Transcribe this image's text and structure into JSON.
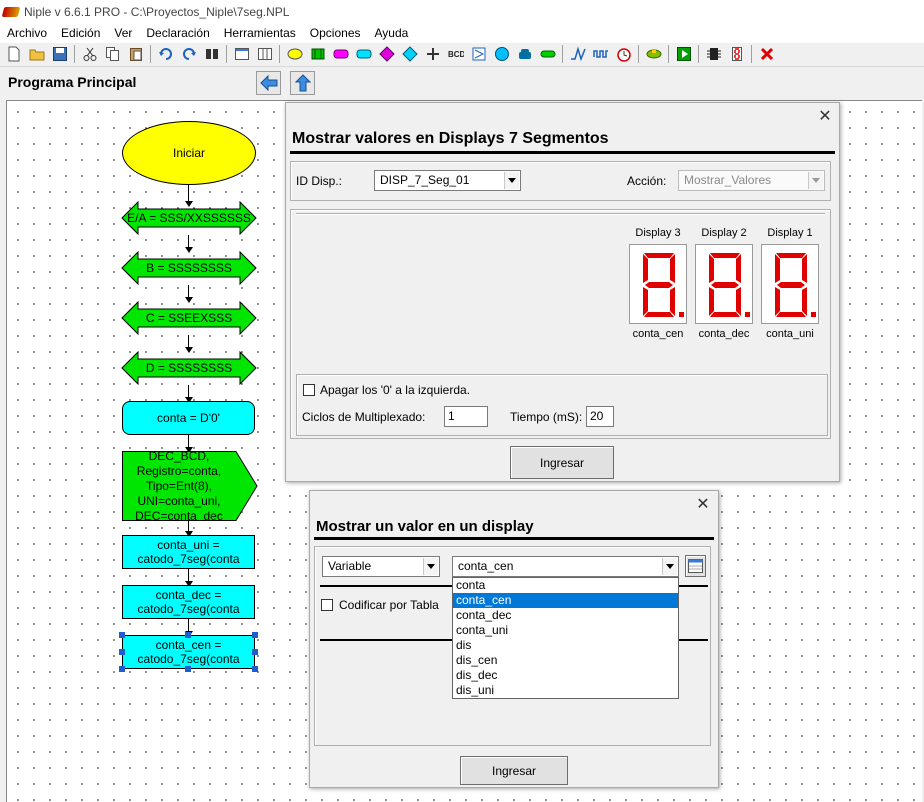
{
  "window": {
    "title": "Niple v 6.6.1 PRO - C:\\Proyectos_Niple\\7seg.NPL"
  },
  "menu": [
    "Archivo",
    "Edición",
    "Ver",
    "Declaración",
    "Herramientas",
    "Opciones",
    "Ayuda"
  ],
  "toolbar_icons": [
    "new-file-icon",
    "open-folder-icon",
    "save-icon",
    "sep",
    "cut-icon",
    "copy-icon",
    "paste-icon",
    "sep",
    "undo-icon",
    "redo-icon",
    "find-icon",
    "sep",
    "window-icon",
    "grid-icon",
    "sep",
    "ellipse-icon",
    "routine-icon",
    "io-data-icon",
    "process-icon",
    "decision-icon",
    "decision-alt-icon",
    "connector-icon",
    "bcd-icon",
    "display-icon",
    "lcd-icon",
    "phone-icon",
    "stop-icon",
    "sep",
    "pulse-icon",
    "wave-icon",
    "clock-icon",
    "sep",
    "toggle-icon",
    "sep",
    "run-icon",
    "sep",
    "chip-icon",
    "seven-seg-icon",
    "sep",
    "close-icon"
  ],
  "bcd_label": "BCD",
  "program": {
    "title": "Programa Principal"
  },
  "flowchart": {
    "start": "Iniciar",
    "steps": [
      "E/A = SSS/XXSSSSSS",
      "B = SSSSSSSS",
      "C = SSEEXSSS",
      "D = SSSSSSSS"
    ],
    "assign": "conta = D'0'",
    "subroutine": "DEC_BCD,\nRegistro=conta,\nTipo=Ent(8),\nUNI=conta_uni,\nDEC=conta_dec",
    "calls": [
      "conta_uni =\ncatodo_7seg(conta",
      "conta_dec =\ncatodo_7seg(conta",
      "conta_cen =\ncatodo_7seg(conta"
    ]
  },
  "dialog1": {
    "title": "Mostrar valores en Displays 7 Segmentos",
    "id_label": "ID Disp.:",
    "id_value": "DISP_7_Seg_01",
    "accion_label": "Acción:",
    "accion_value": "Mostrar_Valores",
    "displays": [
      {
        "name": "Display 3",
        "var": "conta_cen"
      },
      {
        "name": "Display 2",
        "var": "conta_dec"
      },
      {
        "name": "Display 1",
        "var": "conta_uni"
      }
    ],
    "apagar_label": "Apagar los '0' a la izquierda.",
    "apagar_checked": false,
    "ciclos_label": "Ciclos de Multiplexado:",
    "ciclos_value": "1",
    "tiempo_label": "Tiempo (mS):",
    "tiempo_value": "20",
    "ingresar": "Ingresar",
    "segment_color": "#e00000"
  },
  "dialog2": {
    "title": "Mostrar un valor en un display",
    "type_value": "Variable",
    "var_value": "conta_cen",
    "codificar_label": "Codificar por Tabla",
    "codificar_checked": false,
    "options": [
      "conta",
      "conta_cen",
      "conta_dec",
      "conta_uni",
      "dis",
      "dis_cen",
      "dis_dec",
      "dis_uni"
    ],
    "selected_index": 1,
    "ingresar": "Ingresar"
  },
  "close_glyph": "✕"
}
